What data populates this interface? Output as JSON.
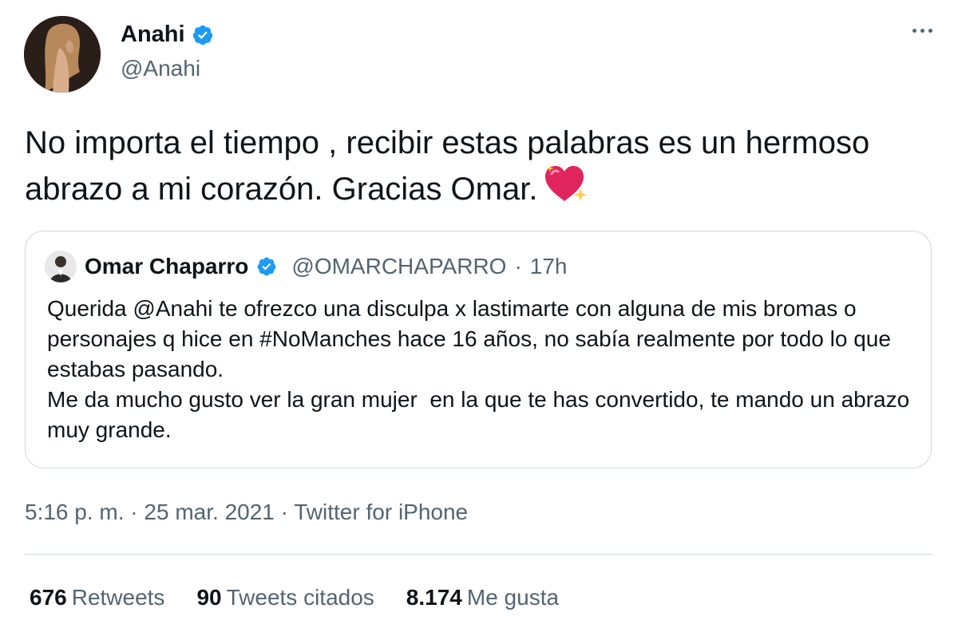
{
  "author": {
    "name": "Anahi",
    "handle": "@Anahi",
    "verified": true
  },
  "tweet": {
    "text": "No importa el tiempo , recibir estas palabras es un hermoso abrazo a mi corazón. Gracias Omar.",
    "emoji": "sparkling-heart-icon"
  },
  "quoted": {
    "name": "Omar Chaparro",
    "handle": "@OMARCHAPARRO",
    "separator": "·",
    "time": "17h",
    "verified": true,
    "text": "Querida @Anahi te ofrezco una disculpa x lastimarte con alguna de mis bromas o personajes q hice en #NoManches hace 16 años, no sabía realmente por todo lo que estabas pasando.\nMe da mucho gusto ver la gran mujer  en la que te has convertido, te mando un abrazo muy grande."
  },
  "meta": {
    "time": "5:16 p. m.",
    "date": "25 mar. 2021",
    "source": "Twitter for iPhone",
    "separator": "·"
  },
  "stats": [
    {
      "count": "676",
      "label": "Retweets"
    },
    {
      "count": "90",
      "label": "Tweets citados"
    },
    {
      "count": "8.174",
      "label": "Me gusta"
    }
  ],
  "colors": {
    "verified": "#1d9bf0",
    "secondary_text": "#536471",
    "border": "#cfd9de"
  }
}
